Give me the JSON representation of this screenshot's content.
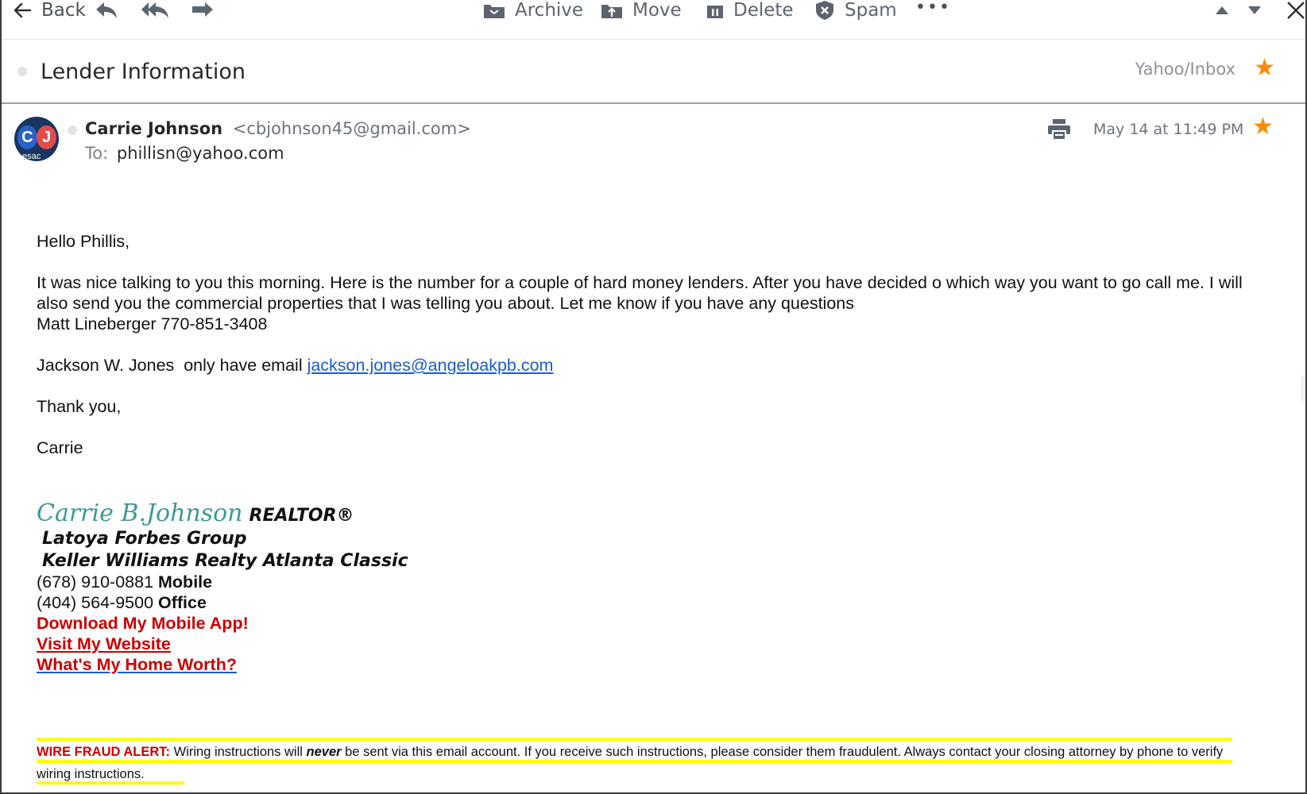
{
  "toolbar": {
    "back_label": "Back",
    "archive_label": "Archive",
    "move_label": "Move",
    "delete_label": "Delete",
    "spam_label": "Spam",
    "more_label": "•••"
  },
  "message": {
    "subject": "Lender Information",
    "folder": "Yahoo/Inbox",
    "sender_name": "Carrie Johnson",
    "sender_email": "<cbjohnson45@gmail.com>",
    "to_label": "To:",
    "recipient": "phillisn@yahoo.com",
    "date": "May 14 at 11:49 PM",
    "avatar_initial_1": "C",
    "avatar_initial_2": "J",
    "avatar_text": "esac"
  },
  "body": {
    "greeting": "Hello Phillis,",
    "paragraph_1": "It was nice talking to you this morning. Here is the number for a couple of hard money  lenders. After you have decided o which way you want to go call me. I will also send you the commercial properties that I was telling you about. Let me know if you have any questions",
    "lender_1": "Matt Lineberger 770-851-3408",
    "lender_2_prefix": "Jackson W. Jones  only have email ",
    "lender_2_email": "jackson.jones@angeloakpb.com",
    "thanks": "Thank you,",
    "sign_off": "Carrie"
  },
  "signature": {
    "name": "Carrie B.Johnson",
    "title": "REALTOR®",
    "group": "Latoya Forbes Group",
    "company": "Keller Williams Realty Atlanta Classic",
    "mobile_number": "(678) 910-0881",
    "mobile_label": "Mobile",
    "office_number": "(404) 564-9500",
    "office_label": "Office",
    "app_link": "Download My Mobile App!",
    "website_link": "Visit My Website",
    "home_worth_link": "What's My Home Worth?"
  },
  "alert": {
    "title": "WIRE FRAUD ALERT:",
    "text_before": " Wiring instructions will ",
    "emphasis": "never",
    "text_after": " be sent via this email account. If you receive such instructions, please consider them fraudulent. Always contact your closing attorney by phone to verify wiring instructions."
  },
  "colors": {
    "star": "#ff8a00",
    "signature_name": "#3a9a96",
    "link_blue": "#1a5bd6",
    "alert_red": "#cc0000",
    "highlight": "#ffff00"
  },
  "icons": [
    "back-arrow-icon",
    "reply-icon",
    "reply-all-icon",
    "forward-icon",
    "archive-icon",
    "move-icon",
    "delete-icon",
    "spam-icon",
    "more-icon",
    "prev-message-icon",
    "next-message-icon",
    "close-icon",
    "star-icon",
    "print-icon"
  ]
}
